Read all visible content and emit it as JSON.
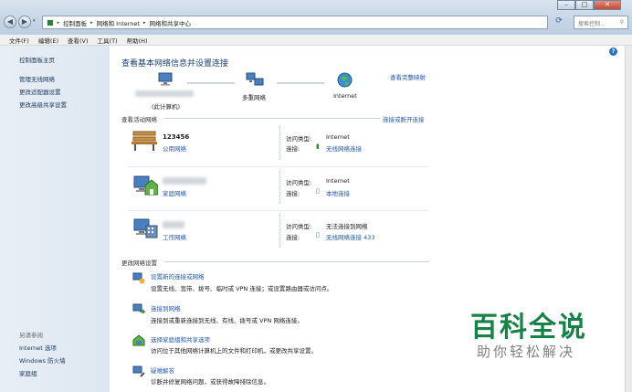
{
  "window": {
    "breadcrumb": [
      "控制面板",
      "网络和 Internet",
      "网络和共享中心"
    ],
    "search_placeholder": "搜索控制..."
  },
  "menu": [
    "文件(F)",
    "编辑(E)",
    "查看(V)",
    "工具(T)",
    "帮助(H)"
  ],
  "sidebar": {
    "home": "控制面板主页",
    "items": [
      "管理无线网络",
      "更改适配器设置",
      "更改高级共享设置"
    ],
    "see_also_header": "另请参阅",
    "see_also": [
      "Internet 选项",
      "Windows 防火墙",
      "家庭组"
    ]
  },
  "main": {
    "title": "查看基本网络信息并设置连接",
    "view_full_map": "查看完整映射",
    "map": {
      "computer": "(此计算机)",
      "network": "多重网络",
      "internet": "Internet"
    },
    "active_header": "查看活动网络",
    "connect_disconnect": "连接或断开连接",
    "networks": [
      {
        "name": "123456",
        "type": "公用网络",
        "access_label": "访问类型:",
        "access": "Internet",
        "conn_label": "连接:",
        "conn": "无线网络连接"
      },
      {
        "name": "",
        "type": "家庭网络",
        "access_label": "访问类型:",
        "access": "Internet",
        "conn_label": "连接:",
        "conn": "本地连接"
      },
      {
        "name": "",
        "type": "工作网络",
        "access_label": "访问类型:",
        "access": "无法连接到网络",
        "conn_label": "连接:",
        "conn": "无线网络连接 433"
      }
    ],
    "change_header": "更改网络设置",
    "tasks": [
      {
        "title": "设置新的连接或网络",
        "desc": "设置无线、宽带、拨号、临时或 VPN 连接；或设置路由器或访问点。"
      },
      {
        "title": "连接到网络",
        "desc": "连接到或重新连接到无线、有线、拨号或 VPN 网络连接。"
      },
      {
        "title": "选择家庭组和共享选项",
        "desc": "访问位于其他网络计算机上的文件和打印机，或更改共享设置。"
      },
      {
        "title": "疑难解答",
        "desc": "诊断并修复网络问题，或获得故障排除信息。"
      }
    ]
  },
  "watermark": {
    "brand": "百科全说",
    "slogan": "助你轻松解决"
  }
}
